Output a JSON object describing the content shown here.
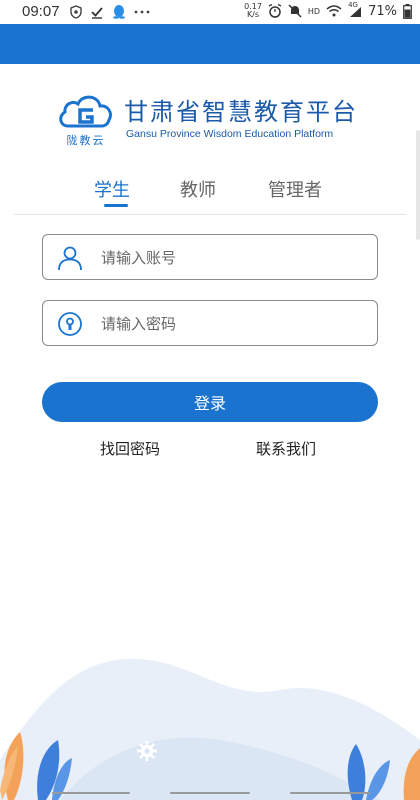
{
  "status_bar": {
    "time": "09:07",
    "net_speed_value": "0.17",
    "net_speed_unit": "K/s",
    "hd_label": "HD",
    "network_label": "4G",
    "battery": "71%",
    "icons": [
      "shield-icon",
      "check-icon",
      "qq-icon",
      "more-icon",
      "alarm-icon",
      "mute-icon",
      "wifi-icon",
      "signal-icon",
      "battery-icon"
    ]
  },
  "brand": {
    "title": "甘肃省智慧教育平台",
    "subtitle_en": "Gansu Province Wisdom Education Platform",
    "logo_text": "陇教云",
    "accent": "#1a73cf",
    "dark_blue": "#1a5aa8"
  },
  "tabs": [
    {
      "label": "学生",
      "active": true
    },
    {
      "label": "教师",
      "active": false
    },
    {
      "label": "管理者",
      "active": false
    }
  ],
  "form": {
    "account": {
      "placeholder": "请输入账号",
      "value": "",
      "icon": "user-icon"
    },
    "password": {
      "placeholder": "请输入密码",
      "value": "",
      "icon": "lock-icon"
    },
    "login_label": "登录"
  },
  "links": {
    "recover": "找回密码",
    "contact": "联系我们"
  },
  "footer": {
    "settings_icon": "gear-icon"
  }
}
